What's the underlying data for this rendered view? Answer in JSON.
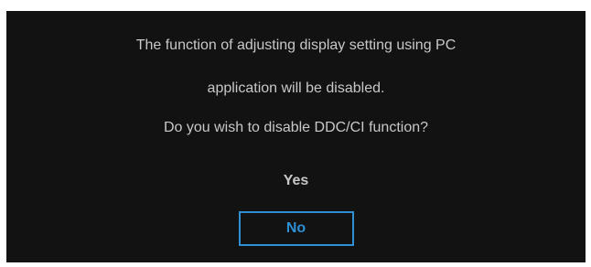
{
  "dialog": {
    "message_line1": "The function of adjusting display setting using PC",
    "message_line2": "application will be disabled.",
    "question": "Do you wish to disable DDC/CI function?",
    "options": [
      {
        "label": "Yes",
        "selected": false
      },
      {
        "label": "No",
        "selected": true
      }
    ]
  },
  "colors": {
    "background": "#121212",
    "text": "#c8c8c8",
    "accent": "#2e8fd3"
  }
}
